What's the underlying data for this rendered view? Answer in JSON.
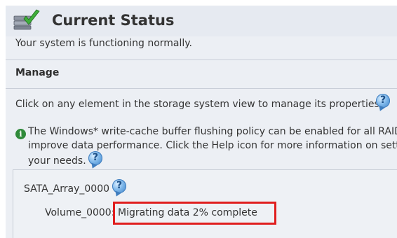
{
  "header": {
    "title": "Current Status",
    "icon": "storage-check-icon"
  },
  "status": {
    "text": "Your system is functioning normally."
  },
  "manage": {
    "heading": "Manage",
    "instruction": "Click on any element in the storage system view to manage its properties.",
    "info_lines": [
      "The Windows* write-cache buffer flushing policy can be enabled for all RAID",
      "improve data performance. Click the Help icon for more information on sett",
      "your needs."
    ]
  },
  "array": {
    "name": "SATA_Array_0000",
    "volume_label": "Volume_0000:",
    "volume_status": "Migrating data 2% complete",
    "progress_percent": 2
  },
  "colors": {
    "highlight_border": "#e01e1e",
    "background": "#eceff4"
  }
}
